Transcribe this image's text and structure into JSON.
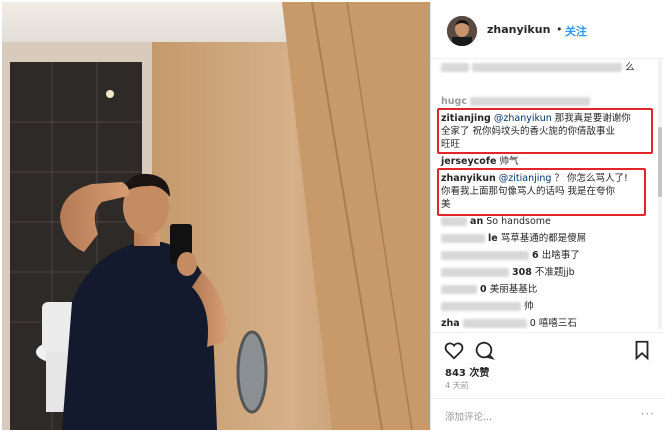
{
  "post": {
    "username": "zhanyikun",
    "separator": "•",
    "follow_label": "关注"
  },
  "comments": [
    {
      "user": "",
      "text": "么"
    },
    {
      "user": "hugc",
      "text": ""
    },
    {
      "user": "zitianjing",
      "mention": "@zhanyikun",
      "lines": [
        "那我真是要谢谢你",
        "全家了 祝你妈坟头的香火旎的你倩敌事业",
        "旺旺"
      ]
    },
    {
      "user": "jerseycofe",
      "text": "帅气"
    },
    {
      "user": "zhanyikun",
      "mention": "@zitianjing",
      "lines": [
        "？ 你怎么骂人了!",
        "你看我上面那句像骂人的话吗 我是在夸你",
        "美"
      ]
    },
    {
      "user": "an",
      "text": "So handsome"
    },
    {
      "user": "le",
      "text": "骂草基通的都是傻屌"
    },
    {
      "user": "6",
      "text": "出啥事了"
    },
    {
      "user": "308",
      "text": "不准题jjb"
    },
    {
      "user": "0",
      "text": "美丽基基比"
    },
    {
      "user": "",
      "text": "帅"
    },
    {
      "user": "zha",
      "text": "0 嘻嘻三石"
    }
  ],
  "stats": {
    "likes": "843 次赞",
    "time": "4 天前"
  },
  "add_comment": {
    "placeholder": "添加评论...",
    "more": "···"
  },
  "colors": {
    "highlight": "#e3242b",
    "follow": "#3897f0",
    "mention": "#003569"
  },
  "icons": [
    "heart-icon",
    "comment-icon",
    "bookmark-icon"
  ]
}
